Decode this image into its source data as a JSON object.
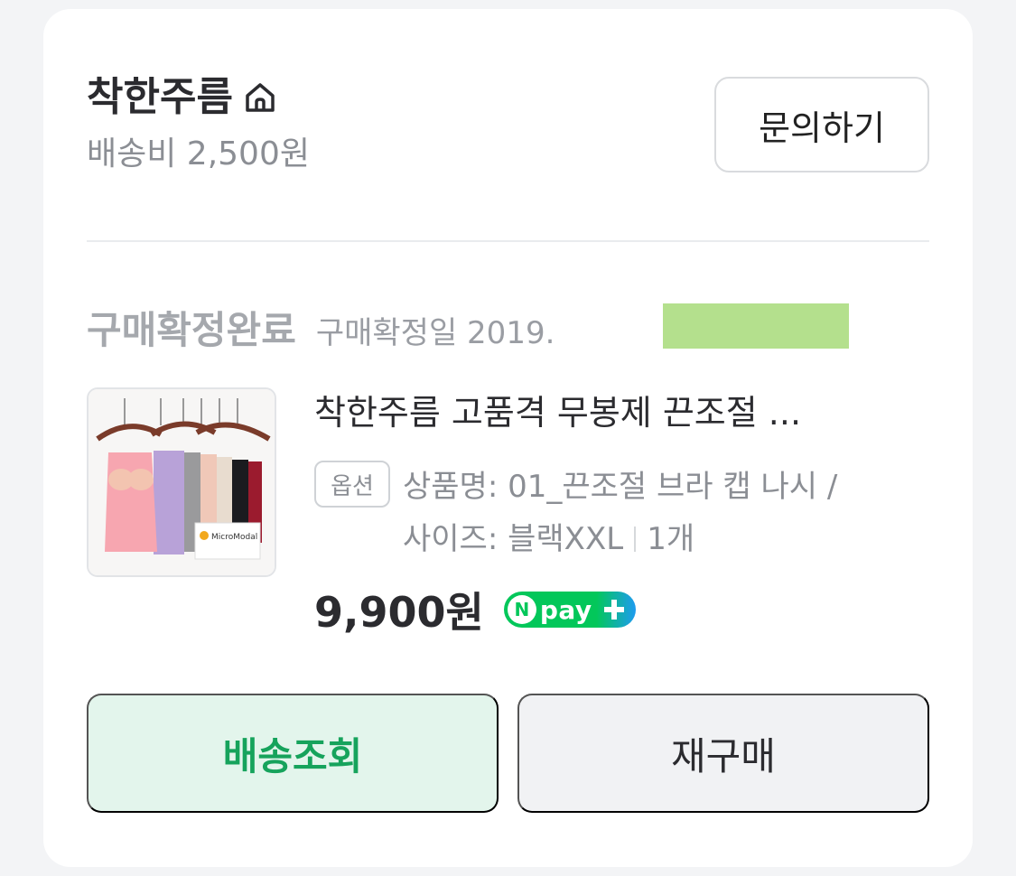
{
  "seller": {
    "name": "착한주름",
    "shipping_fee": "배송비 2,500원",
    "inquiry_label": "문의하기"
  },
  "order": {
    "status": "구매확정완료",
    "confirm_date": "구매확정일 2019."
  },
  "product": {
    "title": "착한주름 고품격 무봉제 끈조절 ...",
    "image_brand": "MicroModal",
    "option_badge": "옵션",
    "option_line1": "상품명: 01_끈조절 브라 캡 나시 /",
    "option_line2_size": "사이즈: 블랙XXL",
    "option_quantity": "1개",
    "price": "9,900원",
    "npay_n": "N",
    "npay_label": "pay"
  },
  "actions": {
    "track_label": "배송조회",
    "rebuy_label": "재구매"
  },
  "colors": {
    "accent_green": "#16a35c",
    "npay_green": "#03c75a",
    "npay_blue": "#1e9bf0",
    "redaction": "#b4e08d"
  }
}
